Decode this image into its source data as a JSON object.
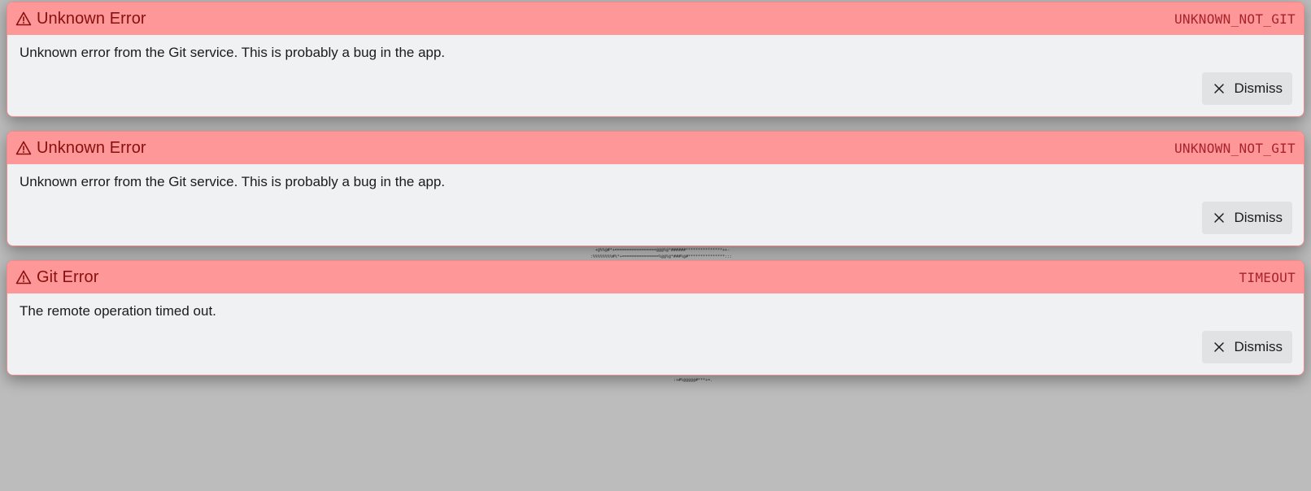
{
  "toasts": [
    {
      "title": "Unknown Error",
      "code": "UNKNOWN_NOT_GIT",
      "message": "Unknown error from the Git service. This is probably a bug in the app.",
      "dismiss_label": "Dismiss"
    },
    {
      "title": "Unknown Error",
      "code": "UNKNOWN_NOT_GIT",
      "message": "Unknown error from the Git service. This is probably a bug in the app.",
      "dismiss_label": "Dismiss"
    },
    {
      "title": "Git Error",
      "code": "TIMEOUT",
      "message": "The remote operation timed out.",
      "dismiss_label": "Dismiss"
    }
  ],
  "colors": {
    "header_bg": "#fe9797",
    "title_text": "#8a0f0f",
    "code_text": "#a8232a",
    "body_bg": "#f0f1f3",
    "backdrop": "#bcbcbc"
  },
  "icons": {
    "header": "warning-triangle-icon",
    "dismiss": "close-icon"
  }
}
